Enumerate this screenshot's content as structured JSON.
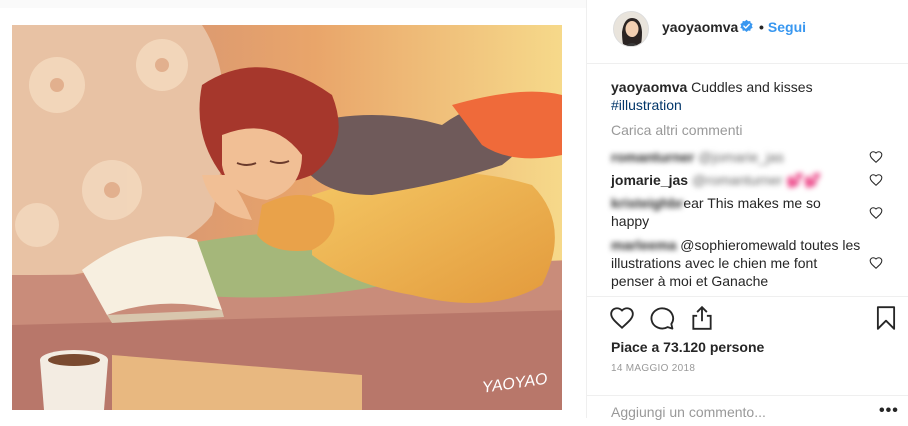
{
  "post": {
    "author": "yaoyaomva",
    "follow_label": "Segui",
    "follow_dot": "•",
    "caption_text": " Cuddles and kisses",
    "hashtag": "#illustration",
    "artwork_signature": "YAOYAO",
    "load_more_label": "Carica altri commenti"
  },
  "comments": [
    {
      "user": "romanturner",
      "text": "@jomarie_jas",
      "blurred": true
    },
    {
      "user": "jomarie_jas",
      "text": "@romanturner 💕💕"
    },
    {
      "user": "kristeighbr",
      "text": "ear This makes me so happy"
    },
    {
      "user": "marleema",
      "text": "@sophieromewald toutes les illustrations avec le chien me font penser à moi et Ganache"
    }
  ],
  "actions": {
    "likes": "Piace a 73.120 persone",
    "date": "14 MAGGIO 2018",
    "add_comment_placeholder": "Aggiungi un commento...",
    "more_label": "•••"
  },
  "icons": {
    "verified": "verified-badge-icon",
    "like": "heart-icon",
    "comment": "comment-bubble-icon",
    "share": "share-icon",
    "save": "bookmark-icon"
  },
  "colors": {
    "link": "#3897f0",
    "verified": "#3897f0",
    "hashtag": "#003569",
    "muted": "#999999",
    "text": "#262626"
  }
}
